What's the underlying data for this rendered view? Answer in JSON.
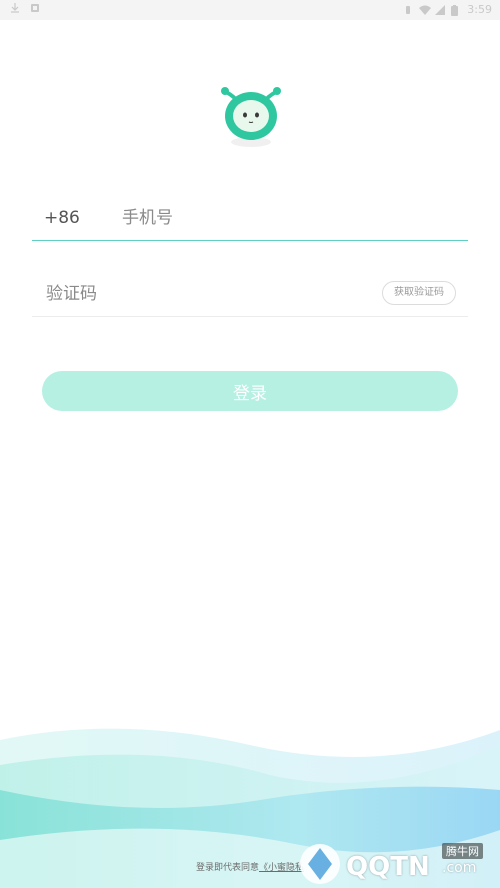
{
  "status_bar": {
    "time": "3:59",
    "icons": [
      "download-icon",
      "notification-icon",
      "vibrate-icon",
      "wifi-icon",
      "signal-icon",
      "battery-icon"
    ]
  },
  "logo": {
    "icon": "robot-mascot-icon",
    "color": "#2fc79f"
  },
  "phone": {
    "prefix": "+86",
    "placeholder": "手机号",
    "value": "",
    "accent": "#5fcfc4"
  },
  "code": {
    "placeholder": "验证码",
    "value": "",
    "get_code_label": "获取验证码"
  },
  "login": {
    "label": "登录",
    "color": "#b6f0e3"
  },
  "agreement": {
    "prefix": "登录即代表同意",
    "policy_link": "《小蜜隐私"
  },
  "watermark": {
    "cn": "腾牛网",
    "text": "QQTN",
    "suffix": ".com"
  }
}
